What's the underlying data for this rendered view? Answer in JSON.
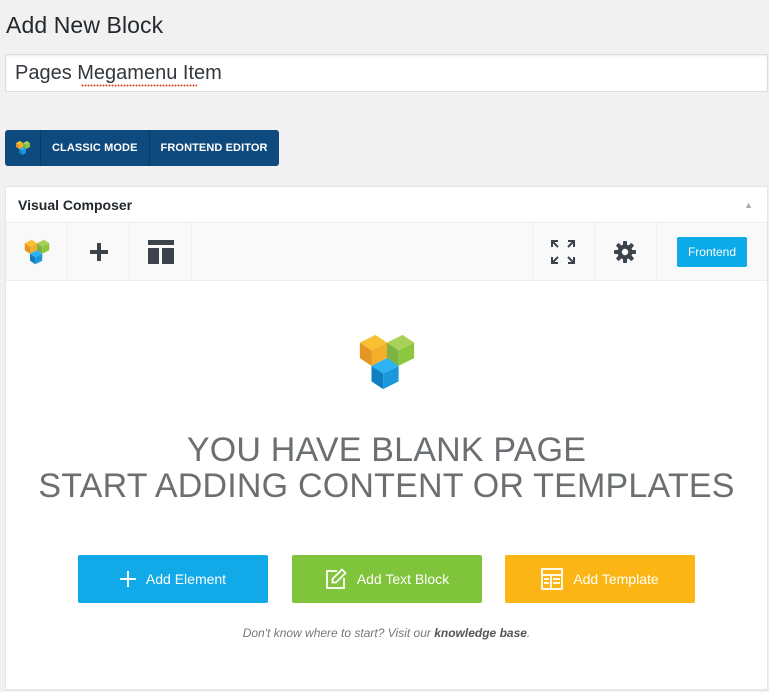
{
  "page": {
    "title": "Add New Block"
  },
  "post": {
    "title_value": "Pages Megamenu Item"
  },
  "mode_bar": {
    "classic_label": "CLASSIC MODE",
    "frontend_editor_label": "FRONTEND EDITOR",
    "logo_icon": "vc-logo-icon"
  },
  "composer": {
    "title": "Visual Composer",
    "toggle_icon": "▲",
    "nav": {
      "logo_icon": "vc-logo-icon",
      "add_icon": "plus-icon",
      "layout_icon": "layout-icon",
      "fullscreen_icon": "fullscreen-icon",
      "settings_icon": "gear-icon",
      "frontend_label": "Frontend"
    },
    "blank": {
      "headline_1": "YOU HAVE BLANK PAGE",
      "headline_2": "START ADDING CONTENT OR TEMPLATES",
      "add_element": "Add Element",
      "add_text_block": "Add Text Block",
      "add_template": "Add Template",
      "hint_prefix": "Don't know where to start? Visit our ",
      "hint_link": "knowledge base",
      "hint_suffix": "."
    }
  },
  "colors": {
    "mode_bar": "#0f4a7e",
    "frontend_button": "#0baae8",
    "add_element": "#11a9e8",
    "add_text_block": "#80c43b",
    "add_template": "#fbb615"
  }
}
